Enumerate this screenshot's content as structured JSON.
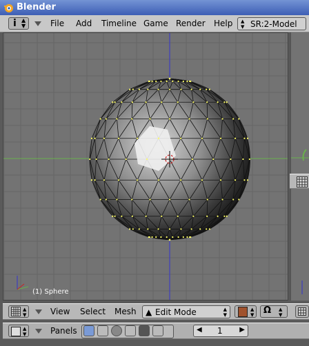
{
  "window": {
    "title": "Blender"
  },
  "menu": {
    "items": [
      "File",
      "Add",
      "Timeline",
      "Game",
      "Render",
      "Help"
    ],
    "scene_selector": "SR:2-Model"
  },
  "viewport": {
    "object_info": "(1) Sphere"
  },
  "view_header": {
    "items": [
      "View",
      "Select",
      "Mesh"
    ],
    "mode_selector": "Edit Mode"
  },
  "buttons_header": {
    "label": "Panels",
    "page_number": "1"
  },
  "colors": {
    "title_bar": "#3d5eb5",
    "viewport_bg": "#737373",
    "axis_x": "#6ab04c",
    "axis_y": "#3333cc",
    "vertex": "#ffff66"
  }
}
